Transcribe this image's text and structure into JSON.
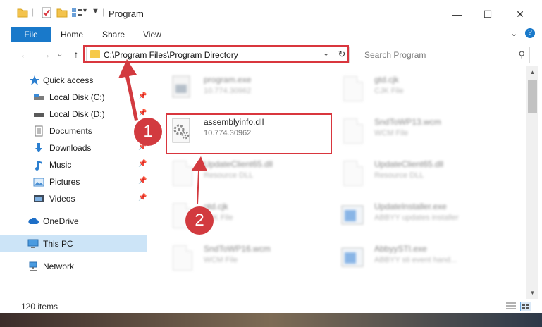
{
  "window": {
    "title": "Program",
    "controls": [
      "—",
      "☐",
      "✕"
    ]
  },
  "ribbon": {
    "tabs": [
      "File",
      "Home",
      "Share",
      "View"
    ],
    "expand_glyph": "⌄",
    "help_glyph": "?"
  },
  "nav": {
    "back_glyph": "←",
    "forward_glyph": "→",
    "recent_glyph": "⌄",
    "up_glyph": "↑"
  },
  "address": {
    "path": "C:\\Program Files\\Program Directory",
    "dropdown_glyph": "⌄",
    "refresh_glyph": "↻"
  },
  "search": {
    "placeholder": "Search Program",
    "icon_glyph": "⚲"
  },
  "sidebar": {
    "items": [
      {
        "label": "Quick access",
        "icon": "star-icon",
        "pinned": false
      },
      {
        "label": "Local Disk (C:)",
        "icon": "drive-icon",
        "pinned": true
      },
      {
        "label": "Local Disk (D:)",
        "icon": "drive-icon",
        "pinned": true
      },
      {
        "label": "Documents",
        "icon": "documents-icon",
        "pinned": true
      },
      {
        "label": "Downloads",
        "icon": "download-icon",
        "pinned": true
      },
      {
        "label": "Music",
        "icon": "music-icon",
        "pinned": true
      },
      {
        "label": "Pictures",
        "icon": "pictures-icon",
        "pinned": true
      },
      {
        "label": "Videos",
        "icon": "videos-icon",
        "pinned": true
      },
      {
        "label": "OneDrive",
        "icon": "cloud-icon",
        "pinned": false
      },
      {
        "label": "This PC",
        "icon": "computer-icon",
        "pinned": false,
        "selected": true
      },
      {
        "label": "Network",
        "icon": "network-icon",
        "pinned": false
      }
    ],
    "pin_glyph": "📌"
  },
  "files": [
    {
      "name": "program.exe",
      "detail": "10.774.30962",
      "icon": "exe-icon",
      "blurred": true
    },
    {
      "name": "gtd.cjk",
      "detail": "CJK File",
      "icon": "file-icon",
      "blurred": true
    },
    {
      "name": "assemblyinfo.dll",
      "detail": "10.774.30962",
      "icon": "dll-gear-icon",
      "blurred": false
    },
    {
      "name": "SndToWP13.wcm",
      "detail": "WCM File",
      "icon": "file-icon",
      "blurred": true
    },
    {
      "name": "UpdateClient65.dll",
      "detail": "Resource DLL",
      "icon": "dll-icon",
      "blurred": true
    },
    {
      "name": "UpdateClient65.dll",
      "detail": "Resource DLL",
      "icon": "dll-icon",
      "blurred": true
    },
    {
      "name": "gtd.cjk",
      "detail": "CJK File",
      "icon": "file-icon",
      "blurred": true
    },
    {
      "name": "UpdateInstaller.exe",
      "detail": "ABBYY updates installer",
      "icon": "installer-icon",
      "blurred": true
    },
    {
      "name": "SndToWP16.wcm",
      "detail": "WCM File",
      "icon": "file-icon",
      "blurred": true
    },
    {
      "name": "AbbyySTI.exe",
      "detail": "ABBYY sti event hand...",
      "icon": "installer-icon",
      "blurred": true
    }
  ],
  "status": {
    "item_count": "120 items"
  },
  "markers": [
    "1",
    "2"
  ],
  "colors": {
    "accent": "#1979ca",
    "highlight": "#d9363e",
    "selected": "#cce4f7"
  }
}
